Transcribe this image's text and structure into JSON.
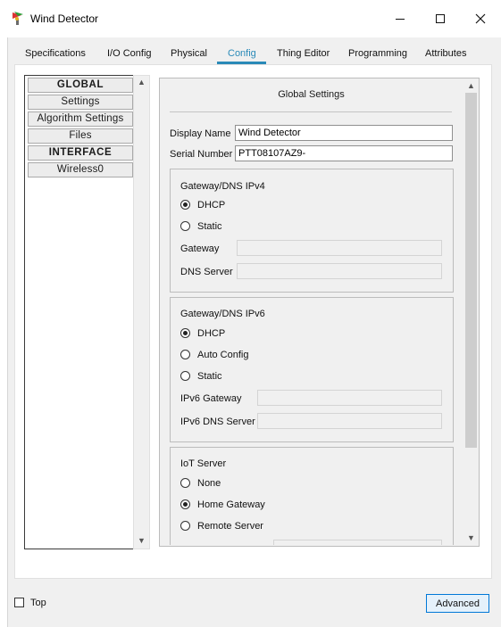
{
  "window": {
    "title": "Wind Detector"
  },
  "tabs": [
    {
      "label": "Specifications"
    },
    {
      "label": "I/O Config"
    },
    {
      "label": "Physical"
    },
    {
      "label": "Config",
      "active": true
    },
    {
      "label": "Thing Editor"
    },
    {
      "label": "Programming"
    },
    {
      "label": "Attributes"
    }
  ],
  "sidebar": {
    "items": [
      {
        "label": "GLOBAL"
      },
      {
        "label": "Settings"
      },
      {
        "label": "Algorithm Settings"
      },
      {
        "label": "Files"
      },
      {
        "label": "INTERFACE"
      },
      {
        "label": "Wireless0"
      }
    ]
  },
  "global_settings": {
    "heading": "Global Settings",
    "display_name_label": "Display Name",
    "display_name_value": "Wind Detector",
    "serial_number_label": "Serial Number",
    "serial_number_value": "PTT08107AZ9-",
    "ipv4": {
      "title": "Gateway/DNS IPv4",
      "dhcp": "DHCP",
      "static": "Static",
      "selected": "DHCP",
      "gateway_label": "Gateway",
      "dns_label": "DNS Server"
    },
    "ipv6": {
      "title": "Gateway/DNS IPv6",
      "dhcp": "DHCP",
      "auto": "Auto Config",
      "static": "Static",
      "selected": "DHCP",
      "gateway_label": "IPv6 Gateway",
      "dns_label": "IPv6 DNS Server"
    },
    "iot": {
      "title": "IoT Server",
      "none": "None",
      "home": "Home Gateway",
      "remote": "Remote Server",
      "selected": "Home Gateway"
    }
  },
  "footer": {
    "top_label": "Top",
    "top_checked": false,
    "advanced_label": "Advanced"
  },
  "colors": {
    "accent": "#2a8ab8",
    "button_border": "#0078d7"
  }
}
